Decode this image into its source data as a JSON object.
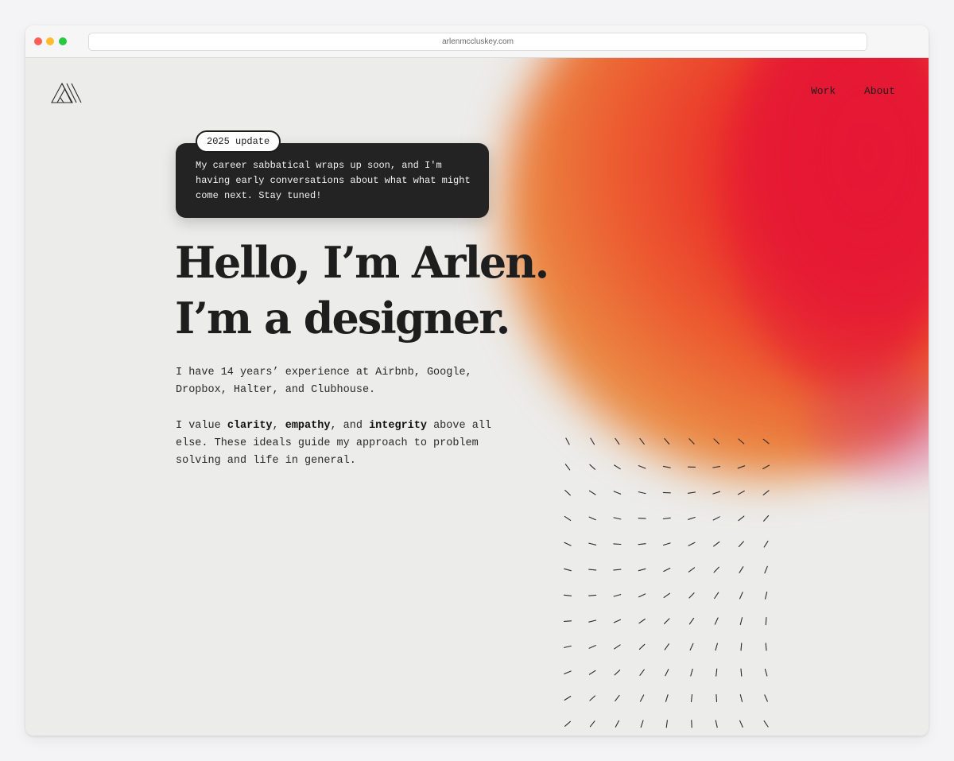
{
  "browser": {
    "url": "arlenmccluskey.com"
  },
  "nav": {
    "work": "Work",
    "about": "About"
  },
  "notice": {
    "badge": "2025 update",
    "text": "My career sabbatical wraps up soon, and I'm having early conversations about what what might come next. Stay tuned!"
  },
  "hero": {
    "line1": "Hello, I’m Arlen.",
    "line2": "I’m a designer."
  },
  "intro": {
    "p1": "I have 14 years’ experience at Airbnb, Google, Dropbox, Halter, and Clubhouse.",
    "p2_start": "I value ",
    "value1": "clarity",
    "sep1": ", ",
    "value2": "empathy",
    "sep2": ", and ",
    "value3": "integrity",
    "p2_end": " above all else. These ideals guide my approach to problem solving and life in general."
  },
  "colors": {
    "accent_red": "#e8162a",
    "accent_orange": "#ea8c44",
    "ink": "#1e1e1e"
  },
  "icons": {
    "logo": "triangle-lines-logo-icon"
  }
}
